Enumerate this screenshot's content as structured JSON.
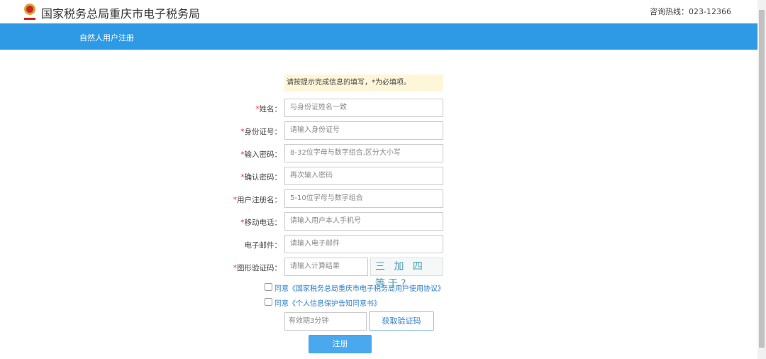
{
  "header": {
    "title": "国家税务总局重庆市电子税务局",
    "hotline": "咨询热线：023-12366"
  },
  "nav": {
    "label": "自然人用户注册"
  },
  "notice": "请按提示完成信息的填写，*为必填项。",
  "fields": [
    {
      "label": "姓名：",
      "required": true,
      "placeholder": "与身份证姓名一致"
    },
    {
      "label": "身份证号：",
      "required": true,
      "placeholder": "请输入身份证号"
    },
    {
      "label": "输入密码：",
      "required": true,
      "placeholder": "8-32位字母与数字组合,区分大小写"
    },
    {
      "label": "确认密码：",
      "required": true,
      "placeholder": "再次输入密码"
    },
    {
      "label": "用户注册名：",
      "required": true,
      "placeholder": "5-10位字母与数字组合"
    },
    {
      "label": "移动电话：",
      "required": true,
      "placeholder": "请输入用户本人手机号"
    },
    {
      "label": "电子邮件：",
      "required": false,
      "placeholder": "请输入电子邮件"
    },
    {
      "label": "图形验证码：",
      "required": true,
      "placeholder": "请输入计算结果"
    }
  ],
  "captcha": "三 加 四 等于?",
  "agreements": [
    "同意《国家税务总局重庆市电子税务局用户使用协议》",
    "同意《个人信息保护告知同意书》"
  ],
  "sms": {
    "placeholder": "有效期3分钟",
    "button": "获取验证码"
  },
  "register": "注册",
  "star": "*"
}
